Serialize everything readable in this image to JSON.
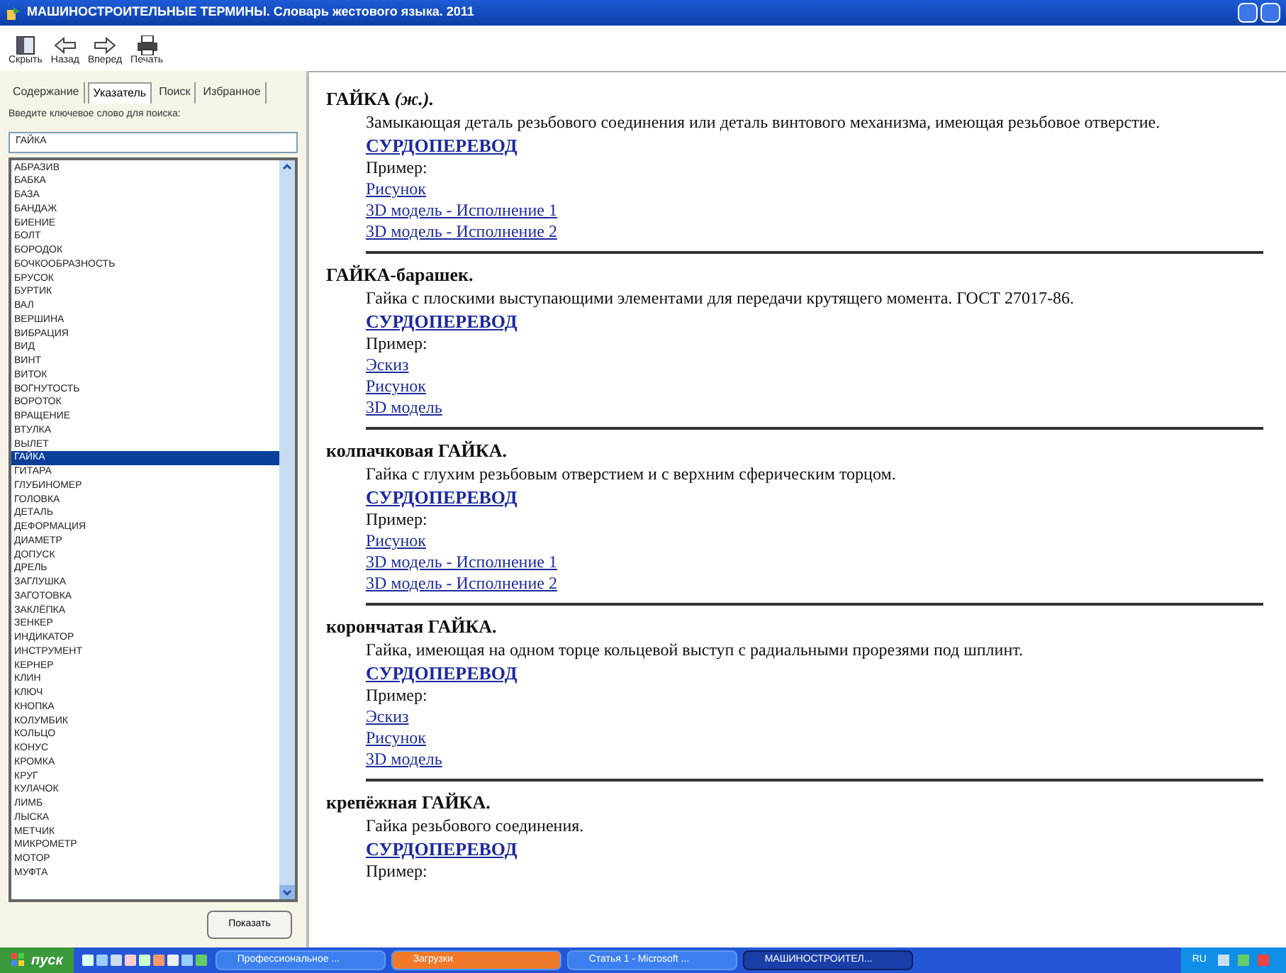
{
  "window": {
    "title": "МАШИНОСТРОИТЕЛЬНЫЕ ТЕРМИНЫ. Словарь жестового языка. 2011"
  },
  "toolbar": [
    {
      "kind": "hide",
      "label": "Скрыть"
    },
    {
      "kind": "back",
      "label": "Назад"
    },
    {
      "kind": "forward",
      "label": "Вперед"
    },
    {
      "kind": "print",
      "label": "Печать"
    }
  ],
  "tabs": [
    {
      "label": "Содержание",
      "selected": false
    },
    {
      "label": "Указатель",
      "selected": true
    },
    {
      "label": "Поиск",
      "selected": false
    },
    {
      "label": "Избранное",
      "selected": false
    }
  ],
  "search": {
    "label": "Введите ключевое слово для поиска:",
    "value": "ГАЙКА"
  },
  "index_items": [
    {
      "label": "АБРАЗИВ",
      "selected": false
    },
    {
      "label": "БАБКА",
      "selected": false
    },
    {
      "label": "БАЗА",
      "selected": false
    },
    {
      "label": "БАНДАЖ",
      "selected": false
    },
    {
      "label": "БИЕНИЕ",
      "selected": false
    },
    {
      "label": "БОЛТ",
      "selected": false
    },
    {
      "label": "БОРОДОК",
      "selected": false
    },
    {
      "label": "БОЧКООБРАЗНОСТЬ",
      "selected": false
    },
    {
      "label": "БРУСОК",
      "selected": false
    },
    {
      "label": "БУРТИК",
      "selected": false
    },
    {
      "label": "ВАЛ",
      "selected": false
    },
    {
      "label": "ВЕРШИНА",
      "selected": false
    },
    {
      "label": "ВИБРАЦИЯ",
      "selected": false
    },
    {
      "label": "ВИД",
      "selected": false
    },
    {
      "label": "ВИНТ",
      "selected": false
    },
    {
      "label": "ВИТОК",
      "selected": false
    },
    {
      "label": "ВОГНУТОСТЬ",
      "selected": false
    },
    {
      "label": "ВОРОТОК",
      "selected": false
    },
    {
      "label": "ВРАЩЕНИЕ",
      "selected": false
    },
    {
      "label": "ВТУЛКА",
      "selected": false
    },
    {
      "label": "ВЫЛЕТ",
      "selected": false
    },
    {
      "label": "ГАЙКА",
      "selected": true
    },
    {
      "label": "ГИТАРА",
      "selected": false
    },
    {
      "label": "ГЛУБИНОМЕР",
      "selected": false
    },
    {
      "label": "ГОЛОВКА",
      "selected": false
    },
    {
      "label": "ДЕТАЛЬ",
      "selected": false
    },
    {
      "label": "ДЕФОРМАЦИЯ",
      "selected": false
    },
    {
      "label": "ДИАМЕТР",
      "selected": false
    },
    {
      "label": "ДОПУСК",
      "selected": false
    },
    {
      "label": "ДРЕЛЬ",
      "selected": false
    },
    {
      "label": "ЗАГЛУШКА",
      "selected": false
    },
    {
      "label": "ЗАГОТОВКА",
      "selected": false
    },
    {
      "label": "ЗАКЛЁПКА",
      "selected": false
    },
    {
      "label": "ЗЕНКЕР",
      "selected": false
    },
    {
      "label": "ИНДИКАТОР",
      "selected": false
    },
    {
      "label": "ИНСТРУМЕНТ",
      "selected": false
    },
    {
      "label": "КЕРНЕР",
      "selected": false
    },
    {
      "label": "КЛИН",
      "selected": false
    },
    {
      "label": "КЛЮЧ",
      "selected": false
    },
    {
      "label": "КНОПКА",
      "selected": false
    },
    {
      "label": "КОЛУМБИК",
      "selected": false
    },
    {
      "label": "КОЛЬЦО",
      "selected": false
    },
    {
      "label": "КОНУС",
      "selected": false
    },
    {
      "label": "КРОМКА",
      "selected": false
    },
    {
      "label": "КРУГ",
      "selected": false
    },
    {
      "label": "КУЛАЧОК",
      "selected": false
    },
    {
      "label": "ЛИМБ",
      "selected": false
    },
    {
      "label": "ЛЫСКА",
      "selected": false
    },
    {
      "label": "МЕТЧИК",
      "selected": false
    },
    {
      "label": "МИКРОМЕТР",
      "selected": false
    },
    {
      "label": "МОТОР",
      "selected": false
    },
    {
      "label": "МУФТА",
      "selected": false
    }
  ],
  "show_button": "Показать",
  "entries": [
    {
      "term": "ГАЙКА *(ж.).*",
      "definition": "Замыкающая деталь резьбового соединения или деталь винтового механизма, имеющая резьбовое отверстие.",
      "sign_link": "СУРДОПЕРЕВОД",
      "example_label": "Пример:",
      "links": [
        "Рисунок",
        "3D модель - Исполнение 1",
        "3D модель - Исполнение 2"
      ]
    },
    {
      "term": "ГАЙКА-барашек.",
      "definition": "Гайка с плоскими выступающими элементами для передачи крутящего момента. ГОСТ 27017-86.",
      "sign_link": "СУРДОПЕРЕВОД",
      "example_label": "Пример:",
      "links": [
        "Эскиз",
        "Рисунок",
        "3D модель"
      ]
    },
    {
      "term": "колпачковая ГАЙКА.",
      "definition": "Гайка с глухим резьбовым отверстием и с верхним сферическим торцом.",
      "sign_link": "СУРДОПЕРЕВОД",
      "example_label": "Пример:",
      "links": [
        "Рисунок",
        "3D модель - Исполнение 1",
        "3D модель - Исполнение 2"
      ]
    },
    {
      "term": "корончатая ГАЙКА.",
      "definition": "Гайка, имеющая на одном торце кольцевой выступ с радиальными прорезями под шплинт.",
      "sign_link": "СУРДОПЕРЕВОД",
      "example_label": "Пример:",
      "links": [
        "Эскиз",
        "Рисунок",
        "3D модель"
      ]
    },
    {
      "term": "крепёжная ГАЙКА.",
      "definition": "Гайка резьбового соединения.",
      "sign_link": "СУРДОПЕРЕВОД",
      "example_label": "Пример:"
    }
  ],
  "taskbar": {
    "start": "пуск",
    "tasks": [
      {
        "label": "Профессиональное ...",
        "flashing": false,
        "selected": false
      },
      {
        "label": "Загрузки",
        "flashing": true,
        "selected": false
      },
      {
        "label": "Статья 1 - Microsoft ...",
        "flashing": false,
        "selected": false
      },
      {
        "label": "МАШИНОСТРОИТЕЛ...",
        "flashing": false,
        "selected": true
      }
    ],
    "language": "RU"
  }
}
